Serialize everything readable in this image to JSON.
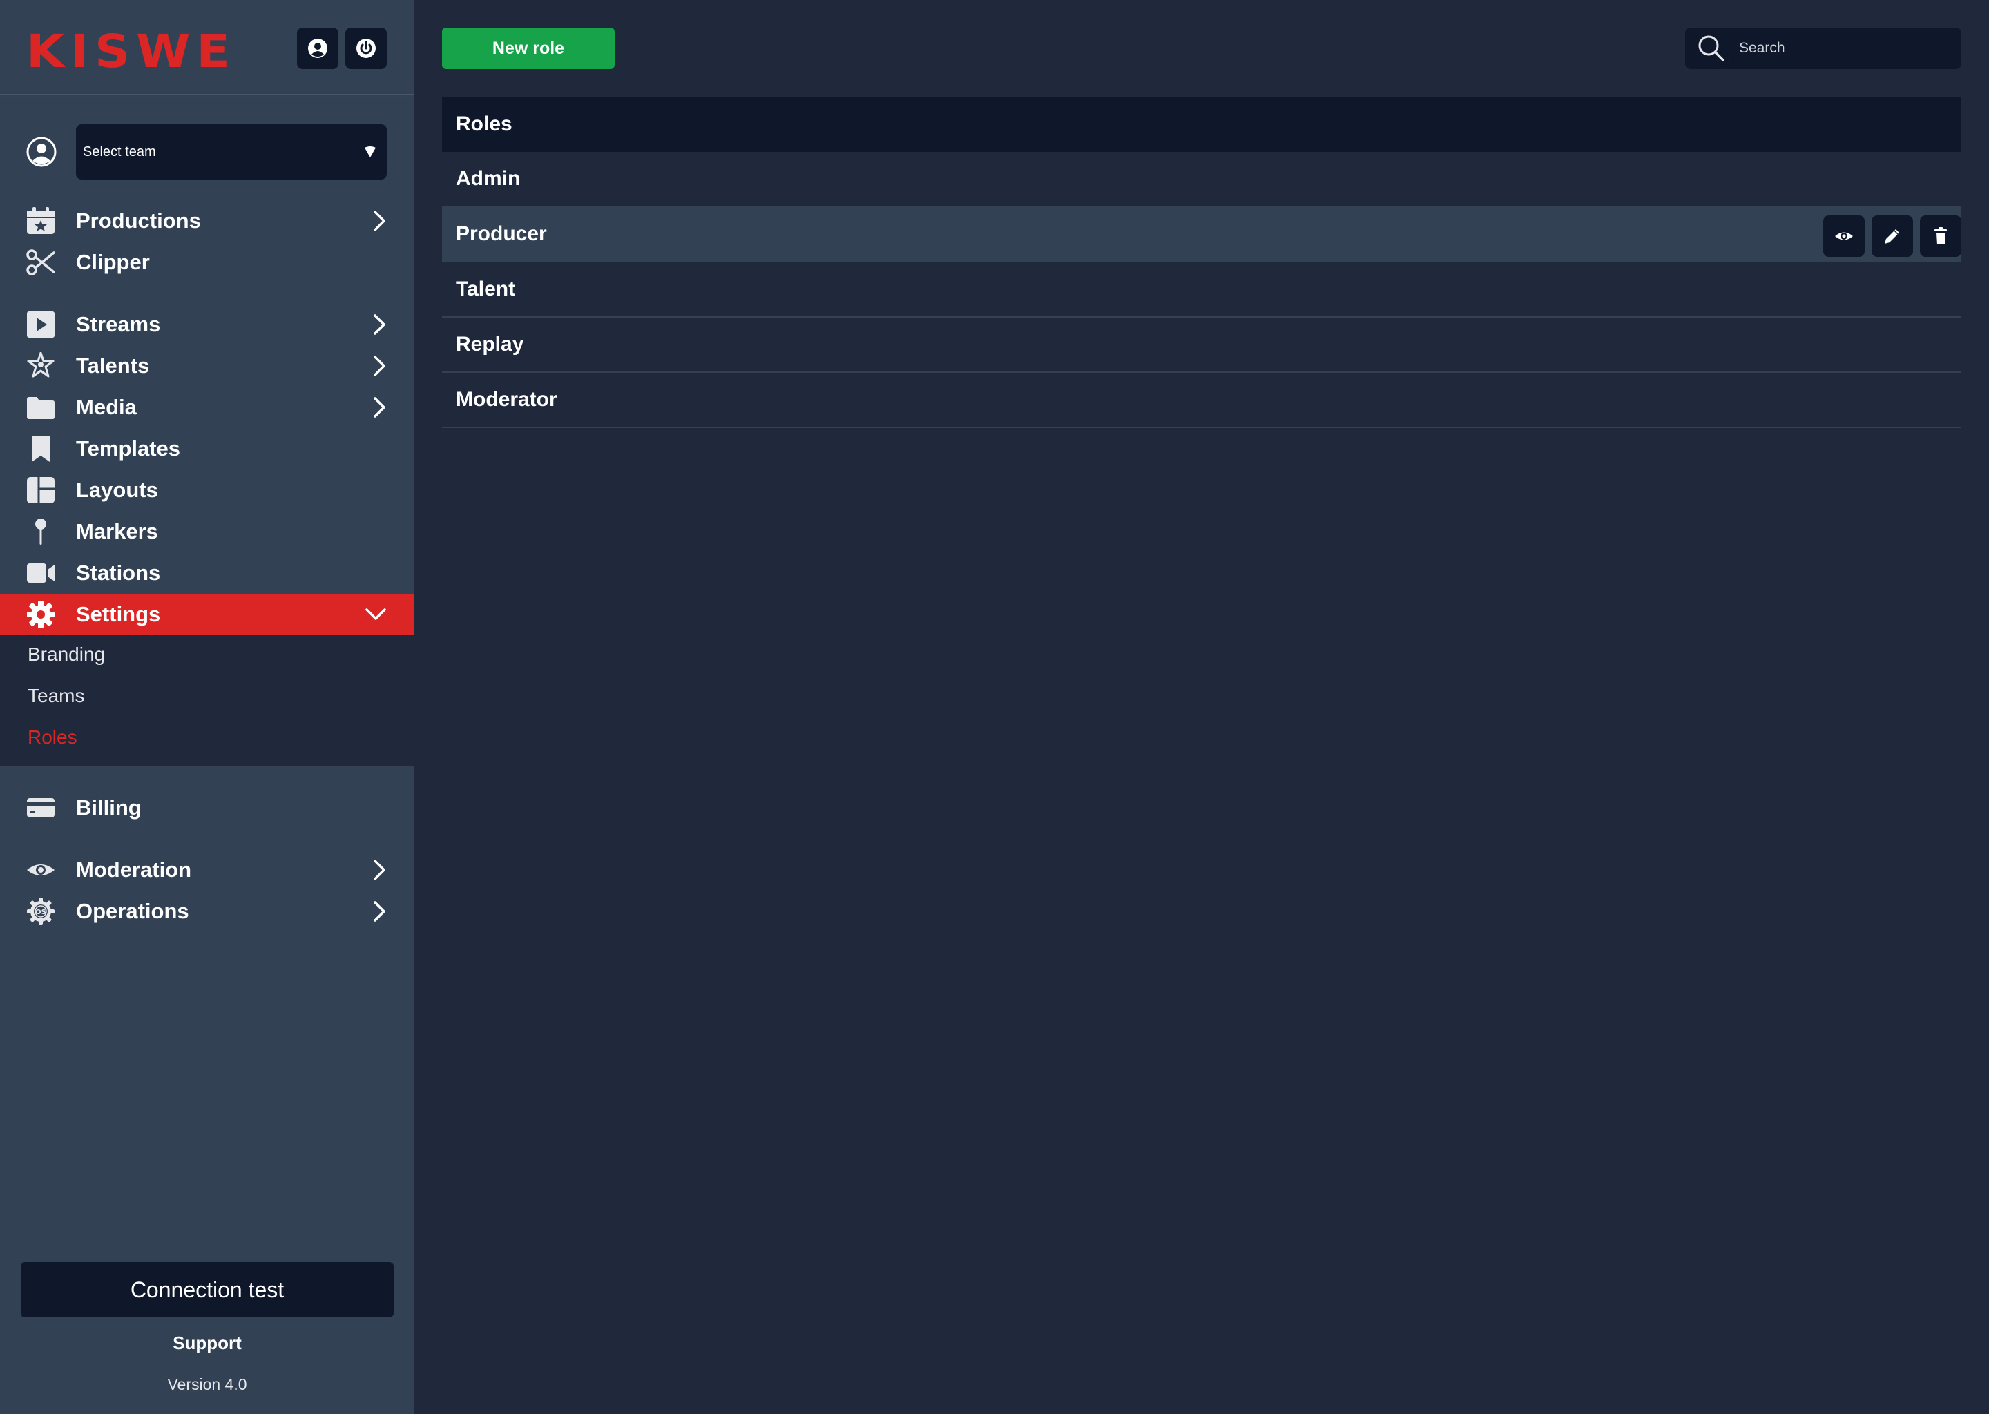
{
  "brand": {
    "logo": "KISWE",
    "accent": "#dc2626"
  },
  "header": {
    "profile_icon": "user-circle-icon",
    "power_icon": "power-icon"
  },
  "team_select": {
    "value": "Select team"
  },
  "nav": {
    "productions": "Productions",
    "clipper": "Clipper",
    "streams": "Streams",
    "talents": "Talents",
    "media": "Media",
    "templates": "Templates",
    "layouts": "Layouts",
    "markers": "Markers",
    "stations": "Stations",
    "settings": "Settings",
    "billing": "Billing",
    "moderation": "Moderation",
    "operations": "Operations"
  },
  "settings_submenu": {
    "branding": "Branding",
    "teams": "Teams",
    "roles": "Roles"
  },
  "footer": {
    "connection_test": "Connection test",
    "support": "Support",
    "version": "Version 4.0"
  },
  "toolbar": {
    "new_role": "New role",
    "search_placeholder": "Search"
  },
  "roles_table": {
    "header": "Roles",
    "rows": [
      "Admin",
      "Producer",
      "Talent",
      "Replay",
      "Moderator"
    ]
  },
  "colors": {
    "sidebar_bg": "#334155",
    "main_bg": "#1f293b",
    "dark": "#0f172a",
    "active": "#dc2626",
    "primary_button": "#16a34a"
  }
}
